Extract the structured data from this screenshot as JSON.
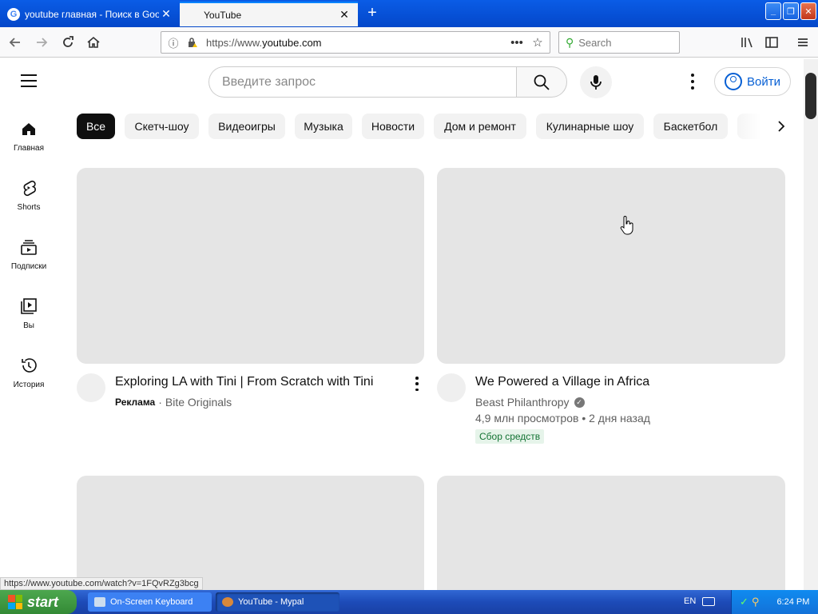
{
  "browser": {
    "tabs": [
      {
        "title": "youtube главная - Поиск в Google",
        "active": false
      },
      {
        "title": "YouTube",
        "active": true
      }
    ],
    "url_prefix": "https://www.",
    "url_domain": "youtube.com",
    "search_placeholder": "Search",
    "status_link": "https://www.youtube.com/watch?v=1FQvRZg3bcg"
  },
  "youtube": {
    "search_placeholder": "Введите запрос",
    "signin_label": "Войти",
    "sidebar": [
      {
        "label": "Главная",
        "icon": "home-icon"
      },
      {
        "label": "Shorts",
        "icon": "shorts-icon"
      },
      {
        "label": "Подписки",
        "icon": "subscriptions-icon"
      },
      {
        "label": "Вы",
        "icon": "you-icon"
      },
      {
        "label": "История",
        "icon": "history-icon"
      }
    ],
    "chips": [
      "Все",
      "Скетч-шоу",
      "Видеоигры",
      "Музыка",
      "Новости",
      "Дом и ремонт",
      "Кулинарные шоу",
      "Баскетбол"
    ],
    "videos": [
      {
        "title": "Exploring LA with Tini | From Scratch with Tini",
        "ad_label": "Реклама",
        "separator": "·",
        "channel": "Bite Originals"
      },
      {
        "title": "We Powered a Village in Africa",
        "channel": "Beast Philanthropy",
        "stats": "4,9 млн просмотров • 2 дня назад",
        "badge": "Сбор средств"
      }
    ]
  },
  "taskbar": {
    "start_label": "start",
    "items": [
      "On-Screen Keyboard",
      "YouTube - Mypal"
    ],
    "language": "EN",
    "time": "6:24 PM"
  },
  "colors": {
    "titlebar": "#0a5ce6",
    "yt_blue": "#065fd4",
    "chip_active": "#0f0f0f",
    "thumb_placeholder": "#e5e5e5",
    "badge_green": "#137333"
  }
}
